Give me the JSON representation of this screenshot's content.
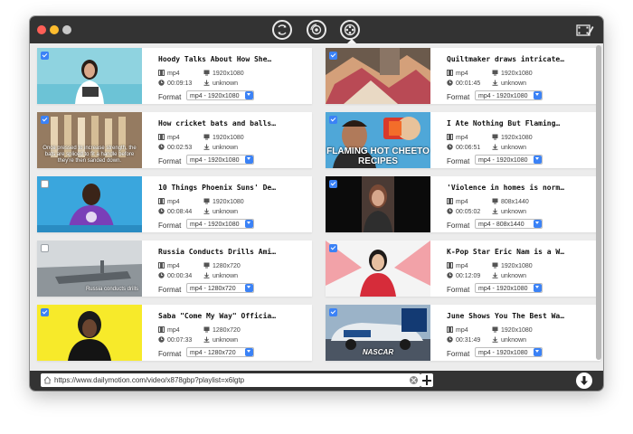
{
  "toolbar": {
    "modes": [
      {
        "name": "convert-mode-icon",
        "active": false
      },
      {
        "name": "record-mode-icon",
        "active": false
      },
      {
        "name": "download-mode-icon",
        "active": true
      }
    ],
    "right_icon": "film-edit-icon"
  },
  "videos": [
    {
      "title": "Hoody Talks About How She…",
      "container": "mp4",
      "resolution": "1920x1080",
      "duration": "00:09:13",
      "size": "unknown",
      "format": "mp4 - 1920x1080",
      "checked": true,
      "caption": ""
    },
    {
      "title": "Quiltmaker draws intricate…",
      "container": "mp4",
      "resolution": "1920x1080",
      "duration": "00:01:45",
      "size": "unknown",
      "format": "mp4 - 1920x1080",
      "checked": true,
      "caption": ""
    },
    {
      "title": "How cricket bats and balls…",
      "container": "mp4",
      "resolution": "1920x1080",
      "duration": "00:02:53",
      "size": "unknown",
      "format": "mp4 - 1920x1080",
      "checked": true,
      "caption": "Once pressed to increase strength, the bats are spliced to fit a handle before they're then sanded down."
    },
    {
      "title": "I Ate Nothing But Flaming…",
      "container": "mp4",
      "resolution": "1920x1080",
      "duration": "00:06:51",
      "size": "unknown",
      "format": "mp4 - 1920x1080",
      "checked": true,
      "caption": "FLAMING HOT CHEETO RECIPES"
    },
    {
      "title": "10 Things Phoenix Suns' De…",
      "container": "mp4",
      "resolution": "1920x1080",
      "duration": "00:08:44",
      "size": "unknown",
      "format": "mp4 - 1920x1080",
      "checked": false,
      "caption": ""
    },
    {
      "title": "'Violence in homes is norm…",
      "container": "mp4",
      "resolution": "808x1440",
      "duration": "00:05:02",
      "size": "unknown",
      "format": "mp4 - 808x1440",
      "checked": true,
      "caption": ""
    },
    {
      "title": "Russia Conducts Drills Ami…",
      "container": "mp4",
      "resolution": "1280x720",
      "duration": "00:00:34",
      "size": "unknown",
      "format": "mp4 - 1280x720",
      "checked": false,
      "caption": "Russia conducts drills"
    },
    {
      "title": "K-Pop Star Eric Nam is a W…",
      "container": "mp4",
      "resolution": "1920x1080",
      "duration": "00:12:09",
      "size": "unknown",
      "format": "mp4 - 1920x1080",
      "checked": true,
      "caption": ""
    },
    {
      "title": "Saba \"Come My Way\" Officia…",
      "container": "mp4",
      "resolution": "1280x720",
      "duration": "00:07:33",
      "size": "unknown",
      "format": "mp4 - 1280x720",
      "checked": true,
      "caption": ""
    },
    {
      "title": "June Shows You The Best Wa…",
      "container": "mp4",
      "resolution": "1920x1080",
      "duration": "00:31:49",
      "size": "unknown",
      "format": "mp4 - 1920x1080",
      "checked": true,
      "caption": "NASCAR"
    }
  ],
  "labels": {
    "format": "Format"
  },
  "url_bar": {
    "value": "https://www.dailymotion.com/video/x878gbp?playlist=x6lgtp"
  },
  "colors": {
    "accent": "#3b82f6",
    "titlebar": "#333333"
  }
}
